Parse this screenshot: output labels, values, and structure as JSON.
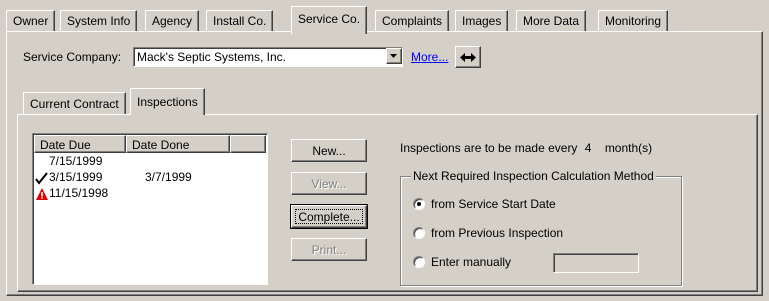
{
  "tabs": [
    {
      "label": "Owner"
    },
    {
      "label": "System Info"
    },
    {
      "label": "Agency"
    },
    {
      "label": "Install Co."
    },
    {
      "label": "Service Co."
    },
    {
      "label": "Complaints"
    },
    {
      "label": "Images"
    },
    {
      "label": "More Data"
    },
    {
      "label": "Monitoring"
    }
  ],
  "service_company": {
    "label": "Service Company:",
    "value": "Mack's Septic Systems, Inc.",
    "more_link": "More..."
  },
  "subtabs": [
    {
      "label": "Current Contract"
    },
    {
      "label": "Inspections"
    }
  ],
  "inspections": {
    "columns": [
      "Date Due",
      "Date Done",
      ""
    ],
    "rows": [
      {
        "icon": "",
        "date_due": "7/15/1999",
        "date_done": ""
      },
      {
        "icon": "checkmark-icon",
        "date_due": "3/15/1999",
        "date_done": "3/7/1999"
      },
      {
        "icon": "warning-icon",
        "date_due": "11/15/1998",
        "date_done": ""
      }
    ],
    "buttons": {
      "new": "New...",
      "view": "View...",
      "complete": "Complete...",
      "print": "Print..."
    },
    "frequency_prefix": "Inspections are to be made every",
    "frequency_value": "4",
    "frequency_unit": "month(s)",
    "method_group": {
      "legend": "Next Required Inspection Calculation Method",
      "options": [
        {
          "label": "from Service Start Date",
          "checked": true
        },
        {
          "label": "from Previous Inspection",
          "checked": false
        },
        {
          "label": "Enter manually",
          "checked": false
        }
      ],
      "manual_value": ""
    }
  },
  "colors": {
    "face": "#d4d0c8",
    "link": "#0000ff",
    "warning": "#e00000"
  }
}
